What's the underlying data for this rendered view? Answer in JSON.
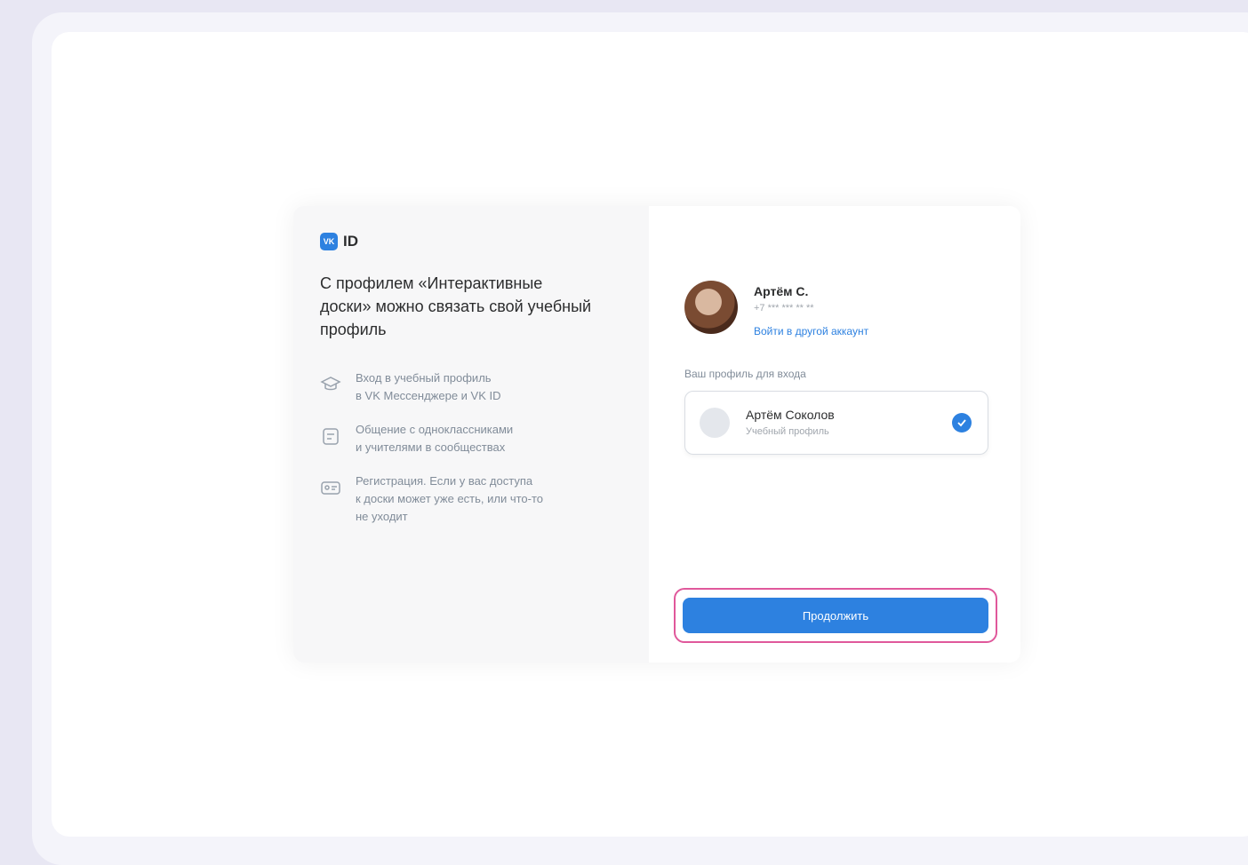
{
  "brand": {
    "logo_text": "VK",
    "name": "ID"
  },
  "intro": {
    "headline": "С профилем «Интерактивные доски» можно связать свой учебный профиль"
  },
  "features": [
    {
      "icon": "graduation-cap-icon",
      "text": "Вход в учебный профиль\nв VK Мессенджере и VK ID"
    },
    {
      "icon": "calendar-icon",
      "text": "Общение с одноклассниками\nи учителями в сообществах"
    },
    {
      "icon": "id-card-icon",
      "text": "Регистрация. Если у вас доступа\nк доски может уже есть, или что-то\nне уходит"
    }
  ],
  "account": {
    "name": "Артём С.",
    "subtitle": "+7 *** *** ** **",
    "switch_link": "Войти в другой аккаунт"
  },
  "profile_section": {
    "label": "Ваш профиль для входа",
    "profile_name": "Артём Соколов",
    "profile_sub": "Учебный профиль"
  },
  "actions": {
    "continue_label": "Продолжить"
  },
  "colors": {
    "accent": "#2d81e0",
    "highlight": "#e0589b",
    "background": "#e8e7f3"
  }
}
